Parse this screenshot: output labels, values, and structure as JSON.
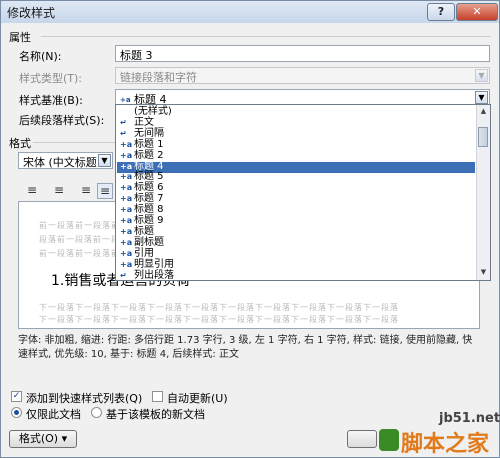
{
  "window": {
    "title": "修改样式",
    "help_label": "?",
    "close_label": "✕"
  },
  "properties": {
    "section_label": "属性",
    "name_label": "名称(N):",
    "name_value": "标题 3",
    "style_type_label": "样式类型(T):",
    "style_type_value": "链接段落和字符",
    "based_on_label": "样式基准(B):",
    "based_on_value": "标题 4",
    "following_label": "后续段落样式(S):"
  },
  "based_on_list": {
    "items": [
      {
        "label": "(无样式)",
        "icon": "none"
      },
      {
        "label": "正文",
        "icon": "paragraph-icon"
      },
      {
        "label": "无间隔",
        "icon": "paragraph-icon"
      },
      {
        "label": "标题 1",
        "icon": "linked-style-icon"
      },
      {
        "label": "标题 2",
        "icon": "linked-style-icon"
      },
      {
        "label": "标题 4",
        "icon": "linked-style-icon",
        "selected": true
      },
      {
        "label": "标题 5",
        "icon": "linked-style-icon"
      },
      {
        "label": "标题 6",
        "icon": "linked-style-icon"
      },
      {
        "label": "标题 7",
        "icon": "linked-style-icon"
      },
      {
        "label": "标题 8",
        "icon": "linked-style-icon"
      },
      {
        "label": "标题 9",
        "icon": "linked-style-icon"
      },
      {
        "label": "标题",
        "icon": "linked-style-icon"
      },
      {
        "label": "副标题",
        "icon": "linked-style-icon"
      },
      {
        "label": "引用",
        "icon": "linked-style-icon"
      },
      {
        "label": "明显引用",
        "icon": "linked-style-icon"
      },
      {
        "label": "列出段落",
        "icon": "paragraph-icon"
      }
    ],
    "style_icon_text": "+a",
    "paragraph_icon_text": "↵"
  },
  "format": {
    "section_label": "格式",
    "font_value": "宋体 (中文标题"
  },
  "preview": {
    "prev_para_line1": "前一段落前一段落前一段落前一段落前一段落前一段落前一段落",
    "prev_para_line2": "段落前一段落前一段落前一段落前一段落前一段落前一段落前一",
    "prev_para_line3": "前一段落前一段落前一段落前一段落前一段落前一段落前一段落",
    "sample_text": "1.销售或者运营的负荷",
    "next_para_line1": "下一段落下一段落下一段落下一段落下一段落下一段落下一段落下一段落下一段落下一段落",
    "next_para_line2": "下一段落下一段落下一段落下一段落下一段落下一段落下一段落下一段落下一段落下一段落"
  },
  "description": "字体: 非加粗, 缩进: 行距: 多倍行距 1.73 字行, 3 级, 左 1 字符, 右 1 字符, 样式: 链接, 使用前隐藏, 快速样式, 优先级: 10, 基于: 标题 4, 后续样式: 正文",
  "options": {
    "add_quick_label": "添加到快速样式列表(Q)",
    "add_quick_checked": true,
    "auto_update_label": "自动更新(U)",
    "auto_update_checked": false,
    "only_doc_label": "仅限此文档",
    "template_label": "基于该模板的新文档"
  },
  "buttons": {
    "format_label": "格式(O)"
  },
  "watermark": {
    "site": "jb51.net",
    "brand": "脚本之家"
  },
  "colors": {
    "selection": "#3d6fb6",
    "accent": "#1a4f9c"
  }
}
